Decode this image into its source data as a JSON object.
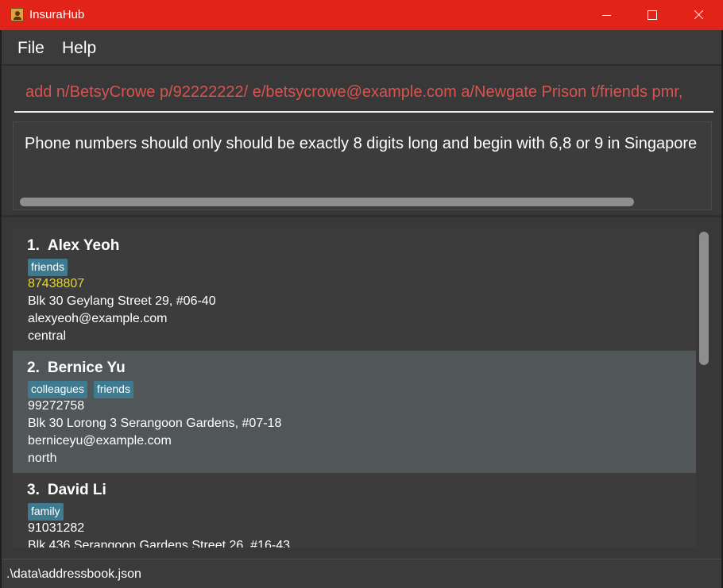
{
  "window": {
    "title": "InsuraHub",
    "app_icon": "address-book-icon",
    "controls": [
      "minimize-icon",
      "maximize-icon",
      "close-icon"
    ]
  },
  "menu": {
    "file": "File",
    "help": "Help"
  },
  "command": {
    "value": "add n/BetsyCrowe p/92222222/ e/betsycrowe@example.com a/Newgate Prison t/friends pmr,"
  },
  "result": {
    "text": "Phone numbers should only should be exactly 8 digits long and begin with 6,8 or 9 in Singapore"
  },
  "persons": [
    {
      "index": "1.",
      "name": "Alex Yeoh",
      "tags": [
        "friends"
      ],
      "phone": "87438807",
      "address": "Blk 30 Geylang Street 29, #06-40",
      "email": "alexyeoh@example.com",
      "region": "central"
    },
    {
      "index": "2.",
      "name": "Bernice Yu",
      "tags": [
        "colleagues",
        "friends"
      ],
      "phone": "99272758",
      "address": "Blk 30 Lorong 3 Serangoon Gardens, #07-18",
      "email": "berniceyu@example.com",
      "region": "north"
    },
    {
      "index": "3.",
      "name": "David Li",
      "tags": [
        "family"
      ],
      "phone": "91031282",
      "address": "Blk 436 Serangoon Gardens Street 26, #16-43",
      "email": "",
      "region": ""
    }
  ],
  "status": {
    "path": ".\\data\\addressbook.json"
  },
  "colors": {
    "titlebar": "#e2231a",
    "command_text": "#d9534f",
    "tag": "#3e7b91",
    "selected_card": "#515658",
    "phone_highlight": "#e6d82a"
  }
}
